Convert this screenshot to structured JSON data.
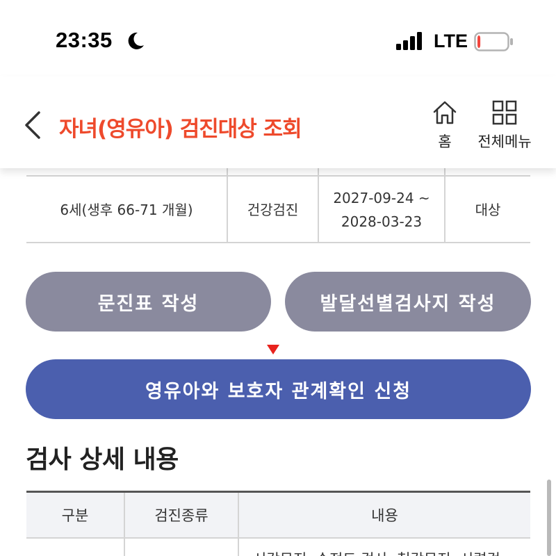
{
  "status_bar": {
    "time": "23:35",
    "moon_icon": "moon-icon",
    "signal_icon": "cellular-signal-icon",
    "network": "LTE",
    "battery_icon": "battery-low-icon",
    "battery_level": 0.1,
    "battery_color": "#f2453d"
  },
  "header": {
    "title": "자녀(영유아) 검진대상 조회",
    "title_color": "#ee4a2c",
    "back_icon": "chevron-left-icon",
    "home": {
      "icon": "home-icon",
      "label": "홈"
    },
    "menu": {
      "icon": "grid-menu-icon",
      "label": "전체메뉴"
    }
  },
  "top_table": {
    "rows": [
      {
        "age": "6세(생후 66-71 개월)",
        "type": "건강검진",
        "period_start": "2027-09-24 ~",
        "period_end": "2028-03-23",
        "status": "대상"
      }
    ]
  },
  "buttons": {
    "questionnaire": "문진표 작성",
    "dev_screening": "발달선별검사지 작성",
    "relation_check": "영유아와 보호자 관계확인 신청",
    "gray_color": "#8a8a9e",
    "blue_color": "#4b5fae",
    "marker_color": "#e8231d"
  },
  "detail": {
    "title": "검사 상세 내용",
    "columns": [
      "구분",
      "검진종류",
      "내용"
    ],
    "first_row_content": "시각문진, 순정도 검사, 청각문진, 시력검"
  }
}
